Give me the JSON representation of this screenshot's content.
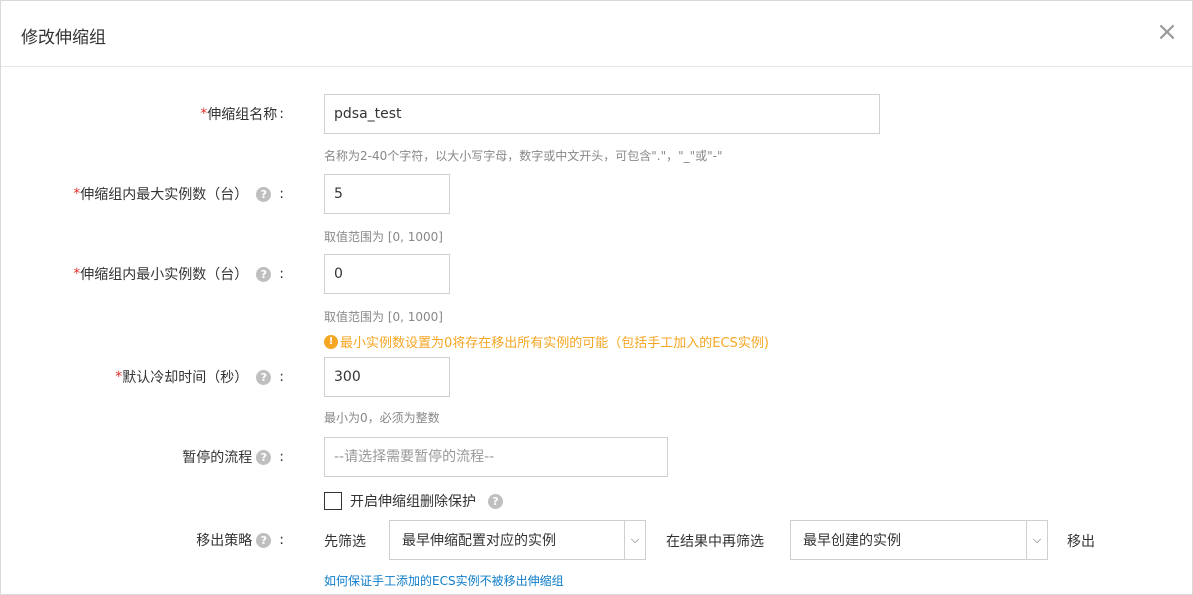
{
  "dialog": {
    "title": "修改伸缩组",
    "close_symbol": "×"
  },
  "fields": {
    "name": {
      "required": "*",
      "label": "伸缩组名称",
      "colon": ":",
      "value": "pdsa_test",
      "hint": "名称为2-40个字符，以大小写字母，数字或中文开头，可包含\".\"，\"_\"或\"-\""
    },
    "max_instances": {
      "required": "*",
      "label": "伸缩组内最大实例数（台）",
      "colon": ":",
      "value": "5",
      "hint": "取值范围为 [0, 1000]"
    },
    "min_instances": {
      "required": "*",
      "label": "伸缩组内最小实例数（台）",
      "colon": ":",
      "value": "0",
      "hint": "取值范围为 [0, 1000]",
      "warning": "最小实例数设置为0将存在移出所有实例的可能（包括手工加入的ECS实例)"
    },
    "cooldown": {
      "required": "*",
      "label": "默认冷却时间（秒）",
      "colon": ":",
      "value": "300",
      "hint": "最小为0，必须为整数"
    },
    "suspended": {
      "label": "暂停的流程",
      "colon": ":",
      "placeholder": "--请选择需要暂停的流程--"
    },
    "delete_protection": {
      "label": "开启伸缩组删除保护",
      "checked": false
    },
    "removal_policy": {
      "label": "移出策略",
      "colon": ":",
      "first_filter_label": "先筛选",
      "first_filter_value": "最早伸缩配置对应的实例",
      "then_filter_label": "在结果中再筛选",
      "then_filter_value": "最早创建的实例",
      "remove_label": "移出",
      "help_link": "如何保证手工添加的ECS实例不被移出伸缩组"
    }
  },
  "icons": {
    "help_glyph": "?",
    "warn_glyph": "!",
    "chevron_glyph": "⌵"
  },
  "colors": {
    "required": "#e0302b",
    "warning": "#f5a623",
    "link": "#0d7dc9"
  }
}
